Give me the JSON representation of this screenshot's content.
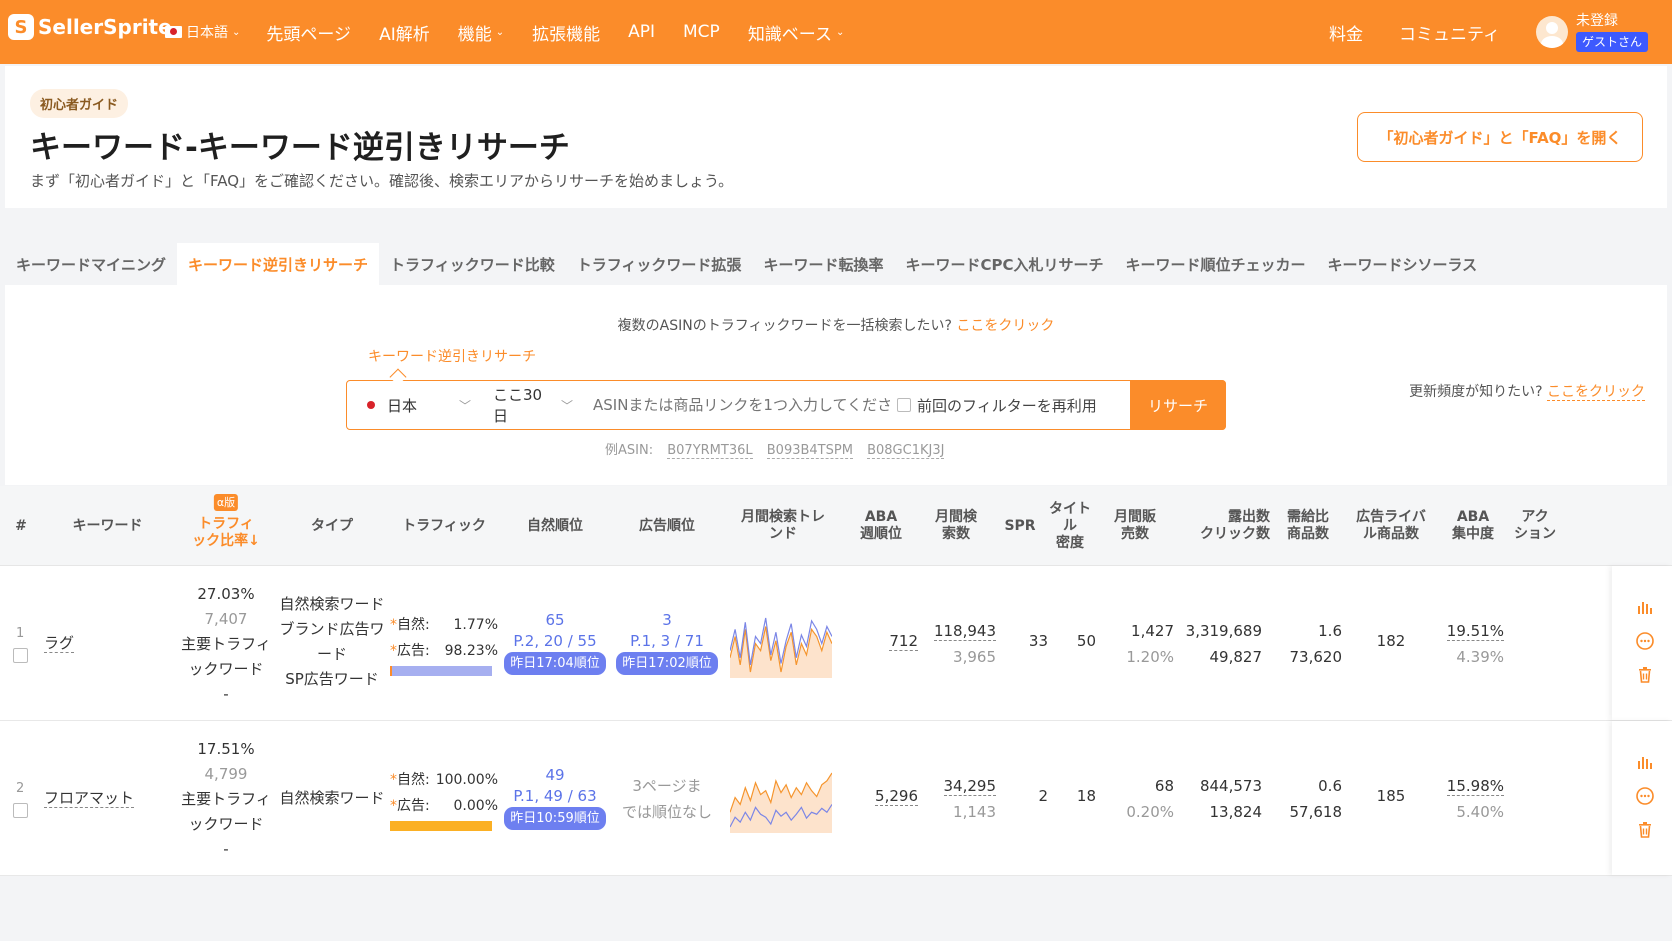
{
  "brand": {
    "logo_text": "SellerSprite",
    "accent": "#fb8c2a"
  },
  "nav": {
    "language": "日本語",
    "items": [
      "先頭ページ",
      "AI解析",
      "機能",
      "拡張機能",
      "API",
      "MCP",
      "知識ベース"
    ],
    "right_items": [
      "料金",
      "コミュニティ"
    ],
    "user_status": "未登録",
    "guest_label": "ゲストさん"
  },
  "header": {
    "tag": "初心者ガイド",
    "title": "キーワード-キーワード逆引きリサーチ",
    "subtitle": "まず「初心者ガイド」と「FAQ」をご確認ください。確認後、検索エリアからリサーチを始めましょう。",
    "guide_button": "「初心者ガイド」と「FAQ」を開く"
  },
  "tabs": [
    {
      "label": "キーワードマイニング",
      "active": false
    },
    {
      "label": "キーワード逆引きリサーチ",
      "active": true
    },
    {
      "label": "トラフィックワード比較",
      "active": false
    },
    {
      "label": "トラフィックワード拡張",
      "active": false
    },
    {
      "label": "キーワード転換率",
      "active": false
    },
    {
      "label": "キーワードCPC入札リサーチ",
      "active": false
    },
    {
      "label": "キーワード順位チェッカー",
      "active": false
    },
    {
      "label": "キーワードシソーラス",
      "active": false
    }
  ],
  "search": {
    "bulk_hint": "複数のASINのトラフィックワードを一括検索したい?",
    "bulk_link": "ここをクリック",
    "mode_label": "キーワード逆引きリサーチ",
    "marketplace": "日本",
    "period": "ここ30日",
    "placeholder": "ASINまたは商品リンクを1つ入力してください",
    "reuse_filter": "前回のフィルターを再利用",
    "button": "リサーチ",
    "update_hint": "更新頻度が知りたい?",
    "update_link": "ここをクリック",
    "examples_label": "例ASIN:",
    "examples": [
      "B07YRMT36L",
      "B093B4TSPM",
      "B08GC1KJ3J"
    ]
  },
  "table": {
    "headers": {
      "index": "#",
      "keyword": "キーワード",
      "alpha": "α版",
      "traffic_ratio": "トラフィ\nック比率↓",
      "type": "タイプ",
      "traffic": "トラフィック",
      "organic_rank": "自然順位",
      "ad_rank": "広告順位",
      "trend": "月間検索トレ\nンド",
      "aba_week": "ABA\n週順位",
      "monthly_search": "月間検\n索数",
      "spr": "SPR",
      "title_density": "タイト\nル\n密度",
      "monthly_sales": "月間販\n売数",
      "impressions": "露出数\nクリック数",
      "supply_demand": "需給比\n商品数",
      "ad_competitors": "広告ライバ\nル商品数",
      "aba_concentration": "ABA\n集中度",
      "action": "アク\nション"
    },
    "rows": [
      {
        "index": "1",
        "keyword": "ラグ",
        "ratio": "27.03%",
        "ratio_count": "7,407",
        "ratio_type_lines": [
          "主要トラフィ",
          "ックワード"
        ],
        "ratio_dash": "-",
        "types": [
          "自然検索ワード",
          "ブランド広告ワ",
          "ード",
          "SP広告ワード"
        ],
        "organic_label": "自然:",
        "organic_pct": "1.77%",
        "ad_label": "広告:",
        "ad_pct": "98.23%",
        "organic_share": 0.0177,
        "organic_rank_main": "65",
        "organic_rank_sub": "P.2, 20 / 55",
        "organic_rank_time": "昨日17:04順位",
        "ad_rank_main": "3",
        "ad_rank_sub": "P.1, 3 / 71",
        "ad_rank_time": "昨日17:02順位",
        "trend_orange": [
          40,
          55,
          35,
          60,
          30,
          50,
          45,
          62,
          38,
          52,
          30,
          48,
          58,
          35,
          50,
          42,
          60,
          55,
          45,
          58,
          50
        ],
        "trend_blue": [
          45,
          60,
          40,
          65,
          35,
          55,
          50,
          68,
          42,
          58,
          36,
          52,
          64,
          40,
          56,
          48,
          66,
          60,
          50,
          62,
          55
        ],
        "aba_week": "712",
        "monthly_search": "118,943",
        "monthly_search_sub": "3,965",
        "spr": "33",
        "title_density": "50",
        "monthly_sales": "1,427",
        "monthly_sales_sub": "1.20%",
        "impressions": "3,319,689",
        "clicks": "49,827",
        "supply_demand": "1.6",
        "products": "73,620",
        "ad_competitors": "182",
        "aba_conc": "19.51%",
        "aba_conc_sub": "4.39%"
      },
      {
        "index": "2",
        "keyword": "フロアマット",
        "ratio": "17.51%",
        "ratio_count": "4,799",
        "ratio_type_lines": [
          "主要トラフィ",
          "ックワード"
        ],
        "ratio_dash": "-",
        "types": [
          "自然検索ワード"
        ],
        "organic_label": "自然:",
        "organic_pct": "100.00%",
        "ad_label": "広告:",
        "ad_pct": "0.00%",
        "organic_share": 1.0,
        "organic_rank_main": "49",
        "organic_rank_sub": "P.1, 49 / 63",
        "organic_rank_time": "昨日10:59順位",
        "ad_rank_none": [
          "3ページま",
          "では順位なし"
        ],
        "trend_orange": [
          30,
          45,
          38,
          55,
          42,
          60,
          48,
          52,
          40,
          62,
          50,
          58,
          45,
          55,
          48,
          60,
          52,
          46,
          58,
          62,
          70
        ],
        "trend_blue": [
          15,
          25,
          20,
          30,
          22,
          35,
          28,
          25,
          18,
          32,
          26,
          30,
          22,
          28,
          35,
          24,
          30,
          28,
          34,
          30,
          38
        ],
        "aba_week": "5,296",
        "monthly_search": "34,295",
        "monthly_search_sub": "1,143",
        "spr": "2",
        "title_density": "18",
        "monthly_sales": "68",
        "monthly_sales_sub": "0.20%",
        "impressions": "844,573",
        "clicks": "13,824",
        "supply_demand": "0.6",
        "products": "57,618",
        "ad_competitors": "185",
        "aba_conc": "15.98%",
        "aba_conc_sub": "5.40%"
      }
    ]
  }
}
